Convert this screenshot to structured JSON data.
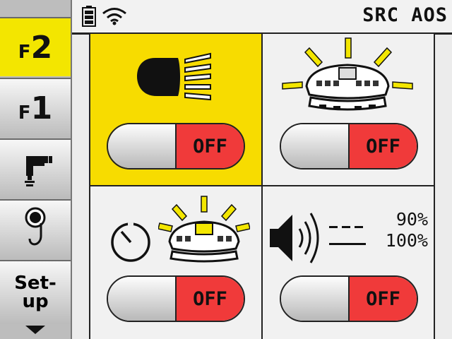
{
  "header": {
    "title": "SRC AOS"
  },
  "sidebar": {
    "items": [
      {
        "prefix": "F",
        "num": "2",
        "active": true
      },
      {
        "prefix": "F",
        "num": "1",
        "active": false
      },
      {
        "icon": "work-light-icon"
      },
      {
        "icon": "hook-icon"
      },
      {
        "line1": "Set-",
        "line2": "up"
      }
    ]
  },
  "tiles": [
    {
      "icon": "headlight-icon",
      "state": "OFF",
      "highlight": "#f7dc00"
    },
    {
      "icon": "machine-beacon-icon",
      "state": "OFF"
    },
    {
      "icon": "delayed-beacon-icon",
      "state": "OFF"
    },
    {
      "icon": "volume-icon",
      "state": "OFF",
      "level_low": "90%",
      "level_high": "100%"
    }
  ],
  "colors": {
    "active_yellow": "#f3e600",
    "off_red": "#f03a3a"
  }
}
